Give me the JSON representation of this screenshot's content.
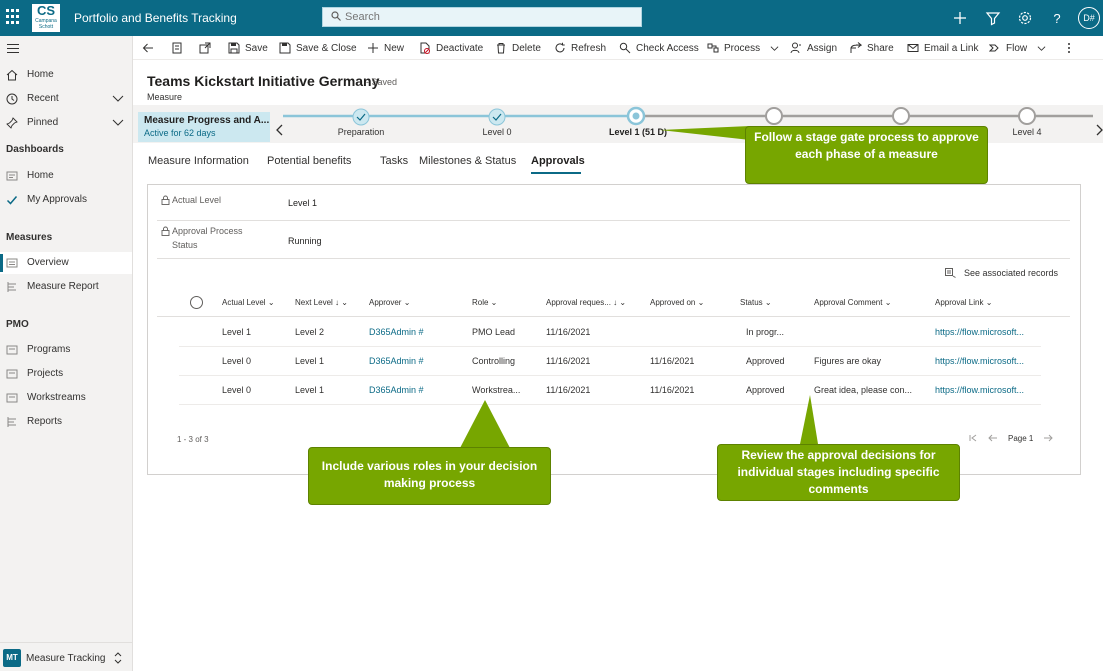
{
  "app": {
    "logo_big": "CS",
    "logo_small": "Campana Schott",
    "title": "Portfolio and Benefits Tracking",
    "search_placeholder": "Search",
    "user_initials": "D#"
  },
  "nav": {
    "items": [
      {
        "label": "Home"
      },
      {
        "label": "Recent"
      },
      {
        "label": "Pinned"
      }
    ],
    "dashboards_group": "Dashboards",
    "dashboards": [
      {
        "label": "Home"
      },
      {
        "label": "My Approvals"
      }
    ],
    "measures_group": "Measures",
    "measures": [
      {
        "label": "Overview"
      },
      {
        "label": "Measure Report"
      }
    ],
    "pmo_group": "PMO",
    "pmo": [
      {
        "label": "Programs"
      },
      {
        "label": "Projects"
      },
      {
        "label": "Workstreams"
      },
      {
        "label": "Reports"
      }
    ],
    "area_badge": "MT",
    "area_label": "Measure Tracking"
  },
  "commands": {
    "save": "Save",
    "save_close": "Save & Close",
    "new": "New",
    "deactivate": "Deactivate",
    "delete": "Delete",
    "refresh": "Refresh",
    "check_access": "Check Access",
    "process": "Process",
    "assign": "Assign",
    "share": "Share",
    "email_link": "Email a Link",
    "flow": "Flow"
  },
  "record": {
    "title": "Teams Kickstart Initiative Germany",
    "saved": "- Saved",
    "entity": "Measure"
  },
  "bpf": {
    "active_name": "Measure Progress and A...",
    "active_sub": "Active for 62 days",
    "stages": [
      "Preparation",
      "Level 0",
      "Level 1 (51 D)",
      "",
      "",
      "Level 4"
    ]
  },
  "tabs": {
    "measure_information": "Measure Information",
    "potential_benefits": "Potential benefits",
    "tasks": "Tasks",
    "milestones": "Milestones & Status",
    "approvals": "Approvals"
  },
  "fields": {
    "actual_level_label": "Actual Level",
    "actual_level_value": "Level 1",
    "approval_status_label_1": "Approval Process",
    "approval_status_label_2": "Status",
    "approval_status_value": "Running"
  },
  "grid": {
    "see_associated": "See associated records",
    "columns": {
      "actual_level": "Actual Level",
      "next_level": "Next Level",
      "approver": "Approver",
      "role": "Role",
      "approval_requested": "Approval reques...",
      "approved_on": "Approved on",
      "status": "Status",
      "comment": "Approval Comment",
      "link": "Approval Link"
    },
    "rows": [
      {
        "actual": "Level 1",
        "next": "Level 2",
        "approver": "D365Admin #",
        "role": "PMO Lead",
        "requested": "11/16/2021",
        "approved_on": "",
        "status": "In progr...",
        "comment": "",
        "link": "https://flow.microsoft..."
      },
      {
        "actual": "Level 0",
        "next": "Level 1",
        "approver": "D365Admin #",
        "role": "Controlling",
        "requested": "11/16/2021",
        "approved_on": "11/16/2021",
        "status": "Approved",
        "comment": "Figures are okay",
        "link": "https://flow.microsoft..."
      },
      {
        "actual": "Level 0",
        "next": "Level 1",
        "approver": "D365Admin #",
        "role": "Workstrea...",
        "requested": "11/16/2021",
        "approved_on": "11/16/2021",
        "status": "Approved",
        "comment": "Great idea, please con...",
        "link": "https://flow.microsoft..."
      }
    ],
    "row_count": "1 - 3 of 3",
    "page_label": "Page 1"
  },
  "callouts": {
    "stage_gate": "Follow a stage gate process to approve each phase of a measure",
    "roles": "Include various roles in your decision making process",
    "review": "Review the approval decisions for individual stages including specific comments"
  },
  "colors": {
    "brand": "#0b6a86",
    "callout": "#77a600"
  }
}
